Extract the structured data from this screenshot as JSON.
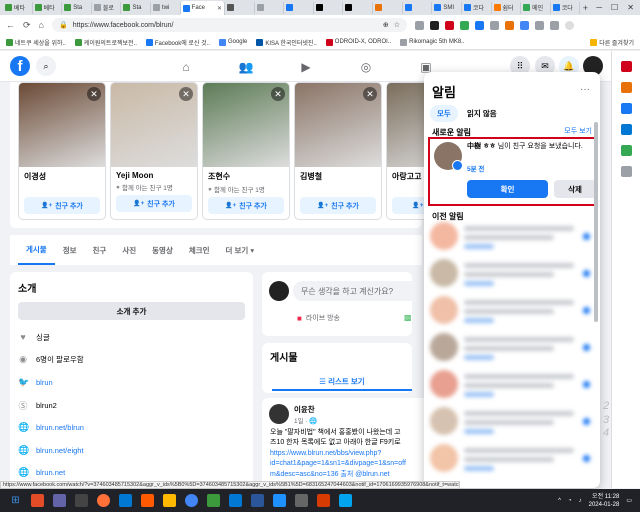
{
  "browser": {
    "tabs": [
      {
        "label": "베타",
        "color": "#3c9a3c",
        "active": false
      },
      {
        "label": "베타",
        "color": "#3c9a3c",
        "active": false
      },
      {
        "label": "Sta",
        "color": "#3c9a3c",
        "active": false
      },
      {
        "label": "블로",
        "color": "#9aa0a6",
        "active": false
      },
      {
        "label": "Sta",
        "color": "#3c9a3c",
        "active": false
      },
      {
        "label": "twi",
        "color": "#9aa0a6",
        "active": false
      },
      {
        "label": "Face",
        "color": "#1877f2",
        "active": true
      },
      {
        "label": "",
        "color": "#555555",
        "active": false
      },
      {
        "label": "",
        "color": "#9aa0a6",
        "active": false
      },
      {
        "label": "",
        "color": "#1877f2",
        "active": false
      },
      {
        "label": "",
        "color": "#000000",
        "active": false
      },
      {
        "label": "",
        "color": "#000000",
        "active": false
      },
      {
        "label": "",
        "color": "#e8710a",
        "active": false
      },
      {
        "label": "",
        "color": "#1877f2",
        "active": false
      },
      {
        "label": "SMI",
        "color": "#1877f2",
        "active": false
      },
      {
        "label": "코다",
        "color": "#1877f2",
        "active": false
      },
      {
        "label": "쉼터",
        "color": "#ff7a00",
        "active": false
      },
      {
        "label": "메인",
        "color": "#34a853",
        "active": false
      },
      {
        "label": "코다",
        "color": "#1877f2",
        "active": false
      }
    ],
    "url": "https://www.facebook.com/blrun/",
    "bookmarks": [
      {
        "label": "네트쿠 세상을 위하..",
        "color": "#3c9a3c"
      },
      {
        "label": "케이원의트로젝보전..",
        "color": "#3c9a3c"
      },
      {
        "label": "Facebook에 로신 것..",
        "color": "#1877f2"
      },
      {
        "label": "Google",
        "color": "#4285f4"
      },
      {
        "label": "KISA 한국인터넷진..",
        "color": "#0057a8"
      },
      {
        "label": "ODROID-X, ODROI..",
        "color": "#d0021b"
      },
      {
        "label": "Rikomagic 5th MK8..",
        "color": "#9aa0a6"
      }
    ],
    "other_bookmarks": "다른 즐겨찾기"
  },
  "profile": {
    "people_you_may_know": [
      {
        "name": "이경성",
        "mutual": "",
        "add_label": "친구 추가",
        "photo": "#6b4a36"
      },
      {
        "name": "Yeji Moon",
        "mutual": "함께 아는 친구 1명",
        "add_label": "친구 추가",
        "photo": "#c9b9a6"
      },
      {
        "name": "조현수",
        "mutual": "함께 아는 친구 1명",
        "add_label": "친구 추가",
        "photo": "#5d7b56"
      },
      {
        "name": "김병철",
        "mutual": "",
        "add_label": "친구 추가",
        "photo": "#8a7466"
      },
      {
        "name": "아랑고고",
        "mutual": "",
        "add_label": "친구 추",
        "photo": "#7a6d5c"
      }
    ],
    "tabs": [
      "게시물",
      "정보",
      "친구",
      "사진",
      "동영상",
      "체크인",
      "더 보기 ▾"
    ],
    "intro": {
      "title": "소개",
      "edit_button": "소개 추가",
      "rows": [
        {
          "icon": "heart-icon",
          "glyph": "♥",
          "text": "싱글",
          "link": false
        },
        {
          "icon": "rss-icon",
          "glyph": "◉",
          "text": "6명이 팔로우함",
          "link": false
        },
        {
          "icon": "twitter-icon",
          "glyph": "🐦",
          "text": "blrun",
          "link": true
        },
        {
          "icon": "skype-icon",
          "glyph": "Ⓢ",
          "text": "blrun2",
          "link": false
        },
        {
          "icon": "globe-icon",
          "glyph": "🌐",
          "text": "blrun.net/blrun",
          "link": true
        },
        {
          "icon": "globe-icon",
          "glyph": "🌐",
          "text": "blrun.net/eight",
          "link": true
        },
        {
          "icon": "globe-icon",
          "glyph": "🌐",
          "text": "blrun.net",
          "link": true
        }
      ]
    },
    "composer": {
      "placeholder": "무슨 생각을 하고 계신가요?",
      "live_label": "라이브 방송"
    },
    "posts": {
      "title": "게시물",
      "list_view": "리스트 보기",
      "author": "이윤찬",
      "time": "1일 · 🌐",
      "text_lines": [
        "오늘 \"팔자비법\" 책에서 홍홍봤이 나왔는데 고",
        "즈10 한자 목록에도 없고 아래아 한글 F9키로",
        "https://www.blrun.net/bbs/view.php?",
        "id=chat1&page=1&sn1=&divpage=1&sn=off",
        "m&desc=asc&no=136 출처 @blrun.net"
      ]
    }
  },
  "notifications": {
    "title": "알림",
    "filter_all": "모두",
    "filter_unread": "읽지 않음",
    "new_section": "새로운 알림",
    "see_all": "모두 보기",
    "friend_request": {
      "name": "中樹 ㅎㅎ",
      "text": "님이 친구 요청을 보냈습니다.",
      "time": "5분 전",
      "confirm": "확인",
      "delete": "삭제"
    },
    "earlier_section": "이전 알림"
  },
  "status_url": "https://www.facebook.com/watch/?v=374603485715302&aggr_v_ids%5B0%5D=374603485715302&aggr_v_ids%5B1%5D=683165247044603&notif_id=1706169935976908&notif_t=watch_follower_video&ref=notif",
  "side_numbers": [
    "2",
    "3",
    "4"
  ],
  "taskbar": {
    "time": "오전 11:28",
    "date": "2024-01-28"
  }
}
